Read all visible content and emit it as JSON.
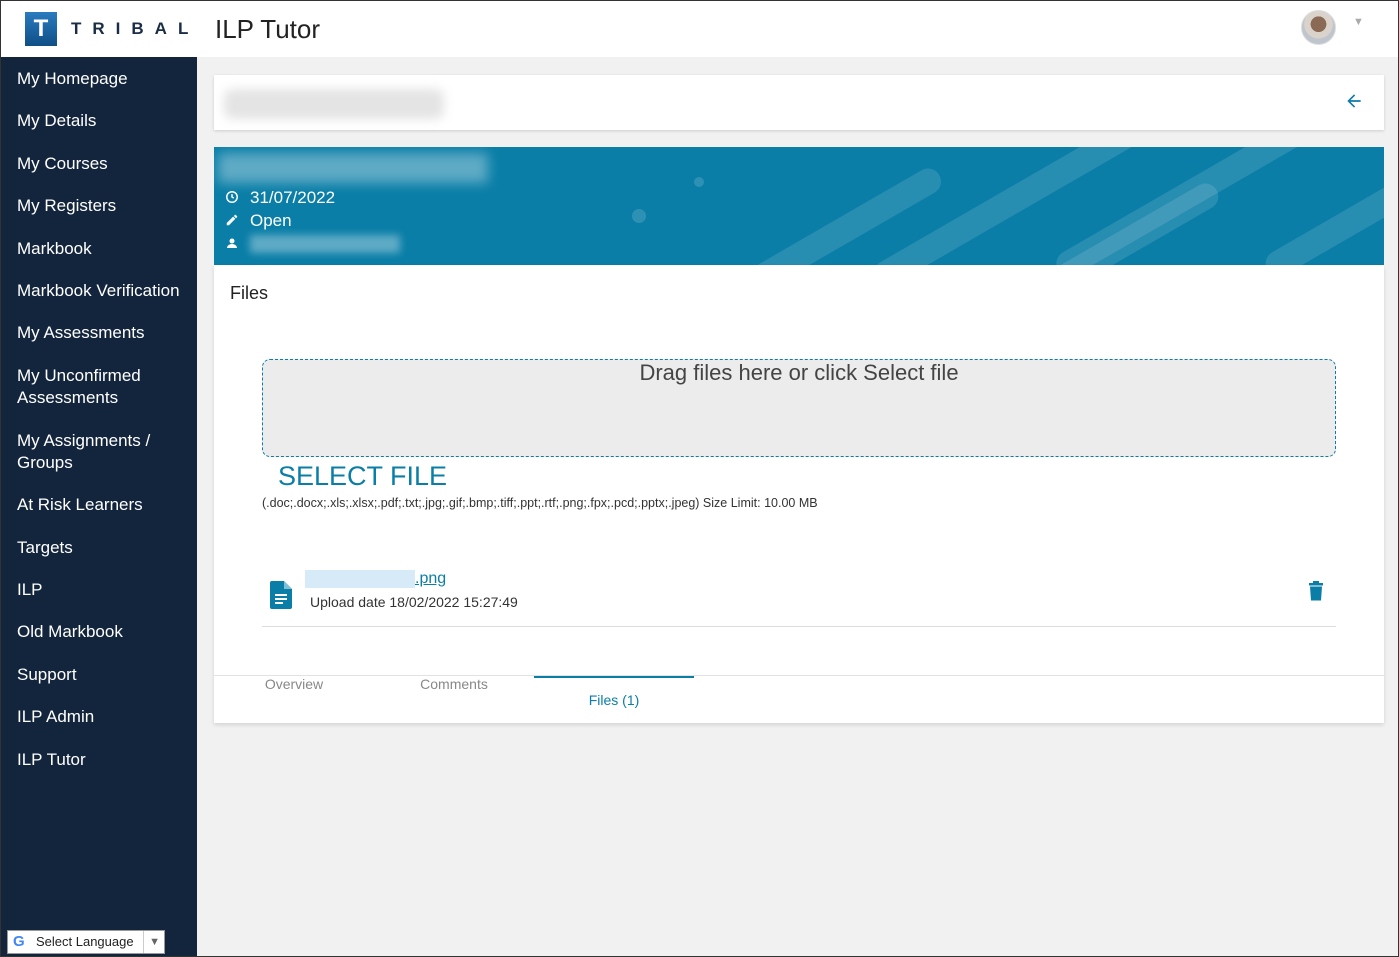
{
  "brand": {
    "logo_letter": "T",
    "logo_text": "TRIBAL"
  },
  "app": {
    "title": "ILP Tutor"
  },
  "sidebar": {
    "items": [
      {
        "label": "My Homepage"
      },
      {
        "label": "My Details"
      },
      {
        "label": "My Courses"
      },
      {
        "label": "My Registers"
      },
      {
        "label": "Markbook"
      },
      {
        "label": "Markbook Verification"
      },
      {
        "label": "My Assessments"
      },
      {
        "label": "My Unconfirmed Assessments"
      },
      {
        "label": "My Assignments / Groups"
      },
      {
        "label": "At Risk Learners"
      },
      {
        "label": "Targets"
      },
      {
        "label": "ILP"
      },
      {
        "label": "Old Markbook"
      },
      {
        "label": "Support"
      },
      {
        "label": "ILP Admin"
      },
      {
        "label": "ILP Tutor"
      }
    ],
    "language": {
      "label": "Select Language",
      "icon": "google-g"
    }
  },
  "banner": {
    "date": "31/07/2022",
    "status": "Open"
  },
  "files": {
    "title": "Files",
    "dropzone_text": "Drag files here or click Select file",
    "select_label": "SELECT FILE",
    "allowed_text": "(.doc;.docx;.xls;.xlsx;.pdf;.txt;.jpg;.gif;.bmp;.tiff;.ppt;.rtf;.png;.fpx;.pcd;.pptx;.jpeg) Size Limit: 10.00 MB",
    "items": [
      {
        "name_suffix": ".png",
        "upload_date": "Upload date 18/02/2022 15:27:49"
      }
    ]
  },
  "tabs": [
    {
      "label": "Overview"
    },
    {
      "label": "Comments"
    },
    {
      "label": "Files (1)"
    }
  ],
  "colors": {
    "accent": "#0a7ea7",
    "sidebar": "#13253d"
  }
}
